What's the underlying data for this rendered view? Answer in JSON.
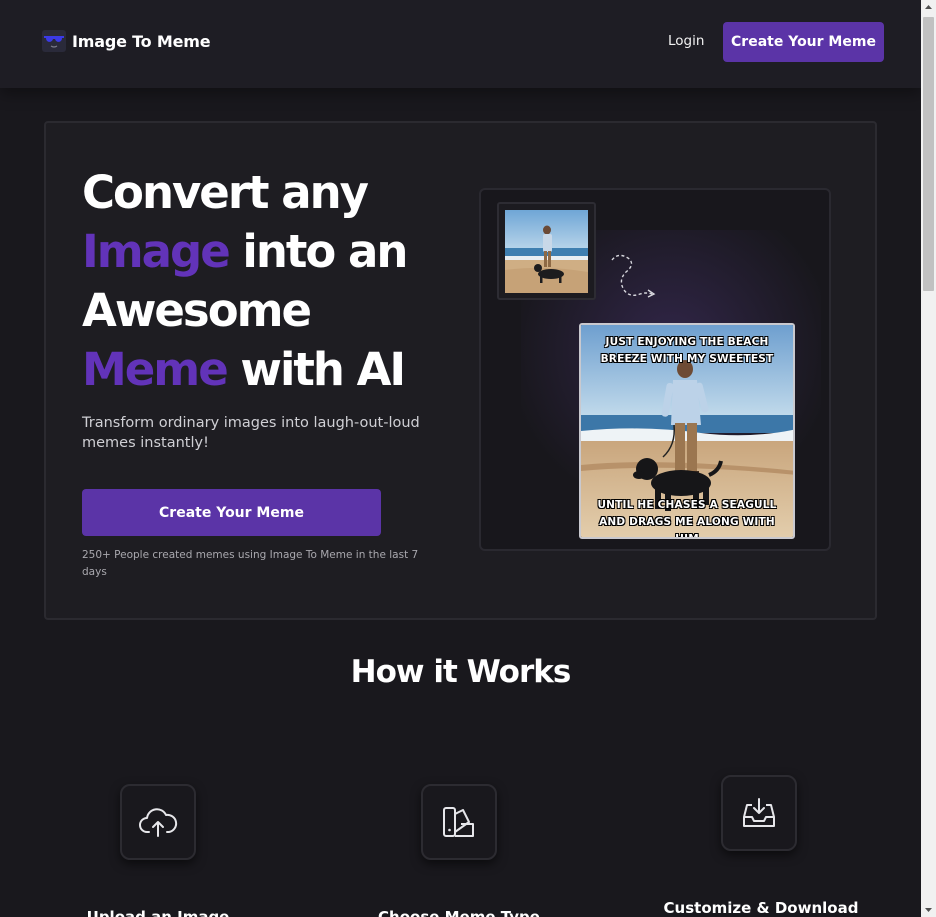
{
  "header": {
    "logo_text": "Image To Meme",
    "logo_icon": "sunglasses-icon",
    "login_label": "Login",
    "cta_label": "Create Your Meme"
  },
  "hero": {
    "headline": {
      "line1": "Convert any",
      "accent1": "Image",
      "line2_rest": "into an",
      "line3": "Awesome",
      "accent2": "Meme",
      "line4_rest": "with AI"
    },
    "subtitle": "Transform ordinary images into laugh-out-loud memes instantly!",
    "cta_label": "Create Your Meme",
    "social_proof": "250+ People created memes using Image To Meme in the last 7 days",
    "meme": {
      "top_caption": "JUST ENJOYING THE BEACH BREEZE WITH MY SWEETEST",
      "bottom_caption": "UNTIL HE CHASES A SEAGULL AND DRAGS ME ALONG WITH HIM"
    }
  },
  "how_it_works": {
    "title": "How it Works",
    "steps": [
      {
        "label": "Upload an Image",
        "icon": "cloud-upload-icon"
      },
      {
        "label": "Choose Meme Type",
        "icon": "swatch-icon"
      },
      {
        "label": "Customize & Download",
        "icon": "download-tray-icon"
      }
    ]
  },
  "colors": {
    "accent": "#5b34a7",
    "accent_text": "#6233b9",
    "background": "#19181d",
    "header": "#1e1d24"
  }
}
